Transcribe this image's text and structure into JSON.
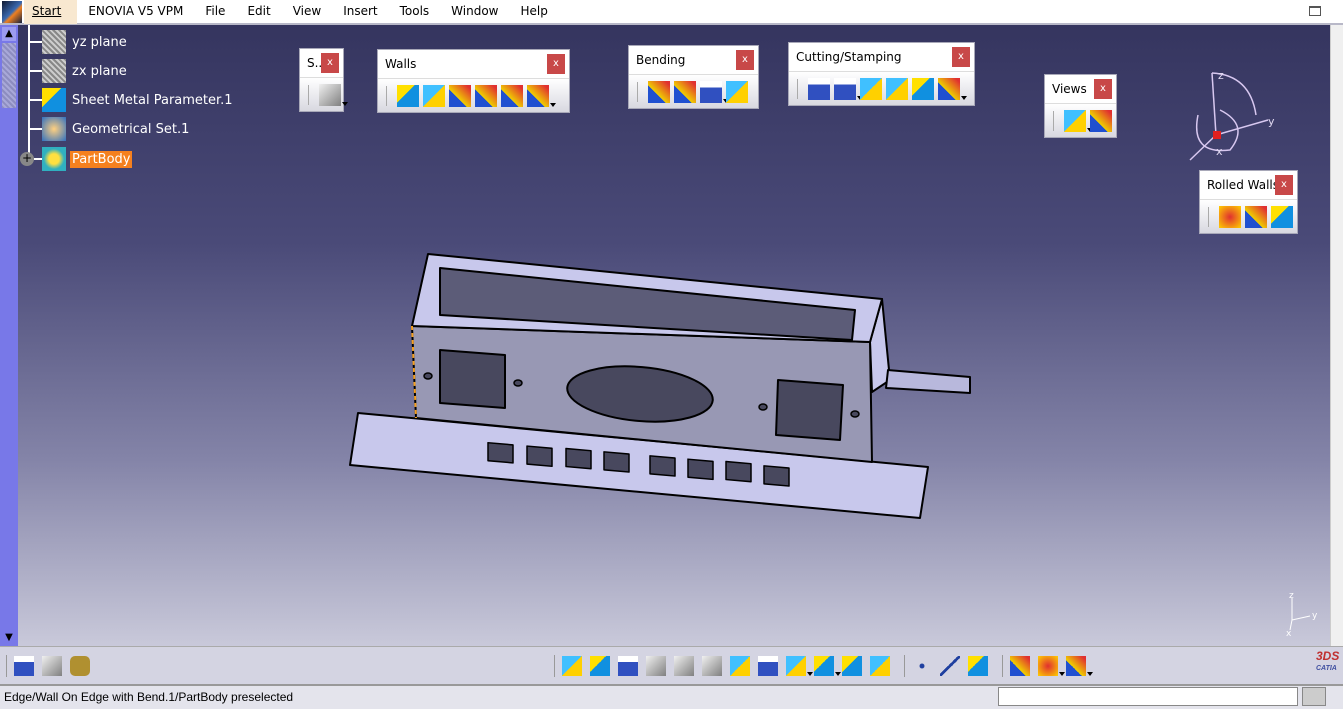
{
  "menubar": {
    "items": [
      "Start",
      "ENOVIA V5 VPM",
      "File",
      "Edit",
      "View",
      "Insert",
      "Tools",
      "Window",
      "Help"
    ]
  },
  "tree": {
    "nodes": [
      {
        "label": "yz plane",
        "icon": "plane-icon"
      },
      {
        "label": "zx plane",
        "icon": "plane-icon"
      },
      {
        "label": "Sheet Metal Parameter.1",
        "icon": "sheet-metal-parameter-icon"
      },
      {
        "label": "Geometrical Set.1",
        "icon": "geometrical-set-icon"
      },
      {
        "label": "PartBody",
        "icon": "part-body-icon",
        "selected": true
      }
    ]
  },
  "toolbars": {
    "sketch": {
      "title": "S...",
      "close": "x"
    },
    "walls": {
      "title": "Walls",
      "close": "x"
    },
    "bending": {
      "title": "Bending",
      "close": "x"
    },
    "cutting": {
      "title": "Cutting/Stamping",
      "close": "x"
    },
    "views": {
      "title": "Views",
      "close": "x"
    },
    "rolled": {
      "title": "Rolled Walls",
      "close": "x"
    }
  },
  "compass": {
    "x": "x",
    "y": "y",
    "z": "z"
  },
  "status": {
    "text": "Edge/Wall On Edge with Bend.1/PartBody preselected",
    "command_value": ""
  },
  "brand": {
    "text": "CATIA"
  },
  "colors": {
    "selection": "#f5801e",
    "part": "#c8c8ec",
    "close": "#c84848"
  }
}
